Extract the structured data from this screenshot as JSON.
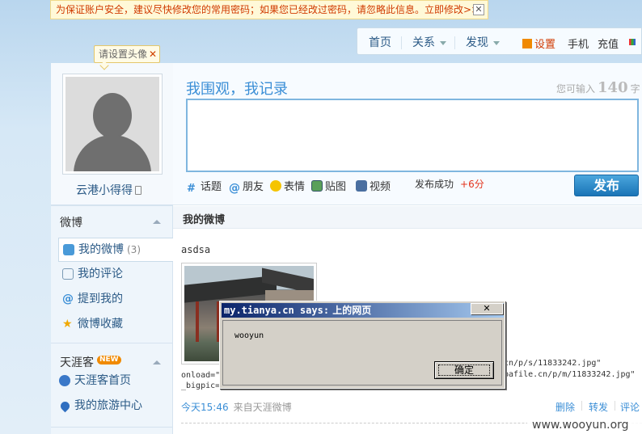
{
  "notice": {
    "text": "为保证账户安全，建议尽快修改您的常用密码；如果您已经改过密码，请忽略此信息。立即修改>>",
    "close": "✕"
  },
  "nav": {
    "home": "首页",
    "relations": "关系",
    "discover": "发现",
    "settings": "设置",
    "mobile": "手机",
    "recharge": "充值"
  },
  "profile": {
    "avatar_tip": "请设置头像",
    "tip_close": "✕",
    "username": "云港小得得"
  },
  "sidebar": {
    "weibo_section": "微博",
    "items": [
      {
        "label": "我的微博",
        "count": "(3)",
        "icon": "user-speech-icon"
      },
      {
        "label": "我的评论",
        "icon": "comment-icon"
      },
      {
        "label": "提到我的",
        "icon": "at-icon"
      },
      {
        "label": "微博收藏",
        "icon": "star-icon"
      }
    ],
    "tianya_section": "天涯客",
    "new_badge": "NEW",
    "tianya_items": [
      {
        "label": "天涯客首页",
        "icon": "globe-icon"
      },
      {
        "label": "我的旅游中心",
        "icon": "location-pin-icon"
      }
    ]
  },
  "publisher": {
    "title": "我围观，我记录",
    "remain_prefix": "您可输入",
    "remain_count": "140",
    "remain_suffix": "字",
    "tools": [
      "话题",
      "朋友",
      "表情",
      "贴图",
      "视频"
    ],
    "success": "发布成功",
    "points": "+6分",
    "send": "发布"
  },
  "feed": {
    "header": "我的微博",
    "post_text": "asdsa",
    "code_line1_left": "onload=\"",
    "code_line1_right": "cn/p/s/11833242.jpg\"",
    "code_line2_left": "_bigpic=",
    "code_line2_right": "bafile.cn/p/m/11833242.jpg\"",
    "time": "今天15:46",
    "source": "来自天涯微博",
    "actions": [
      "删除",
      "转发",
      "评论"
    ]
  },
  "dialog": {
    "title_prefix": "my.tianya.cn says:",
    "title_suffix": "上的网页",
    "close": "✕",
    "message": "wooyun",
    "ok": "确定"
  },
  "watermark": "www.wooyun.org",
  "colors": {
    "link": "#2b5a86",
    "accent": "#3a8ed6",
    "send_button": "#1a74b6",
    "notice_text": "#d03a00",
    "dialog_title": "#0a246a"
  }
}
